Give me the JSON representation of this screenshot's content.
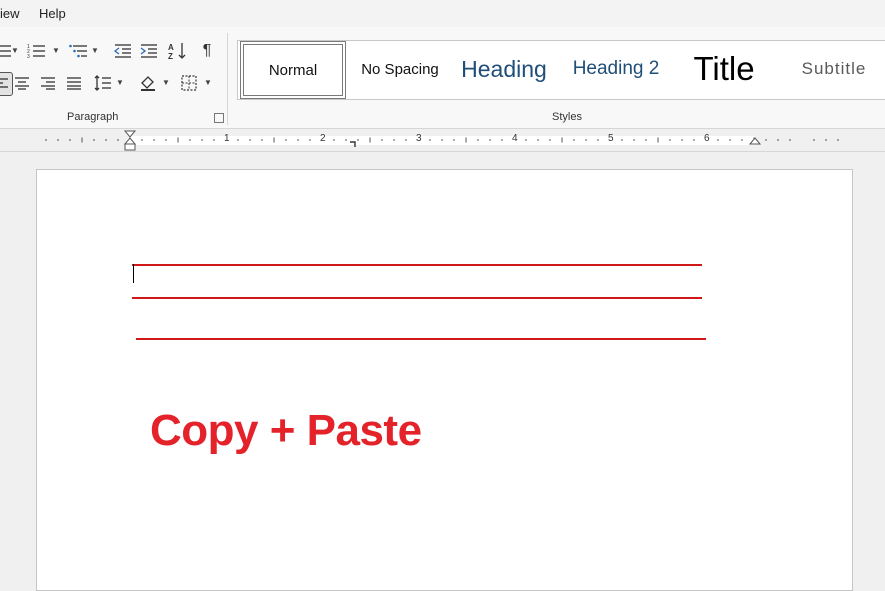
{
  "menu": {
    "view_label": "iew",
    "help_label": "Help"
  },
  "ribbon": {
    "paragraph_group_label": "Paragraph",
    "styles_group_label": "Styles",
    "icons": [
      "bullets-icon",
      "numbering-icon",
      "multilevel-list-icon",
      "decrease-indent-icon",
      "increase-indent-icon",
      "sort-icon",
      "show-formatting-icon",
      "align-left-icon",
      "align-center-icon",
      "align-right-icon",
      "justify-icon",
      "line-spacing-icon",
      "shading-icon",
      "borders-icon",
      "dialog-launcher-icon"
    ],
    "styles": [
      {
        "label": "Normal",
        "selected": true
      },
      {
        "label": "No Spacing"
      },
      {
        "label": "Heading",
        "color": "#1f4e79"
      },
      {
        "label": "Heading 2",
        "color": "#1f4e79"
      },
      {
        "label": "Title"
      },
      {
        "label": "Subtitle",
        "color": "#595959"
      }
    ]
  },
  "ruler": {
    "numbers": [
      "1",
      "2",
      "3",
      "4",
      "5",
      "6"
    ]
  },
  "document": {
    "text": "Copy + Paste",
    "text_color": "#e3222a",
    "line_color": "#d01818"
  }
}
